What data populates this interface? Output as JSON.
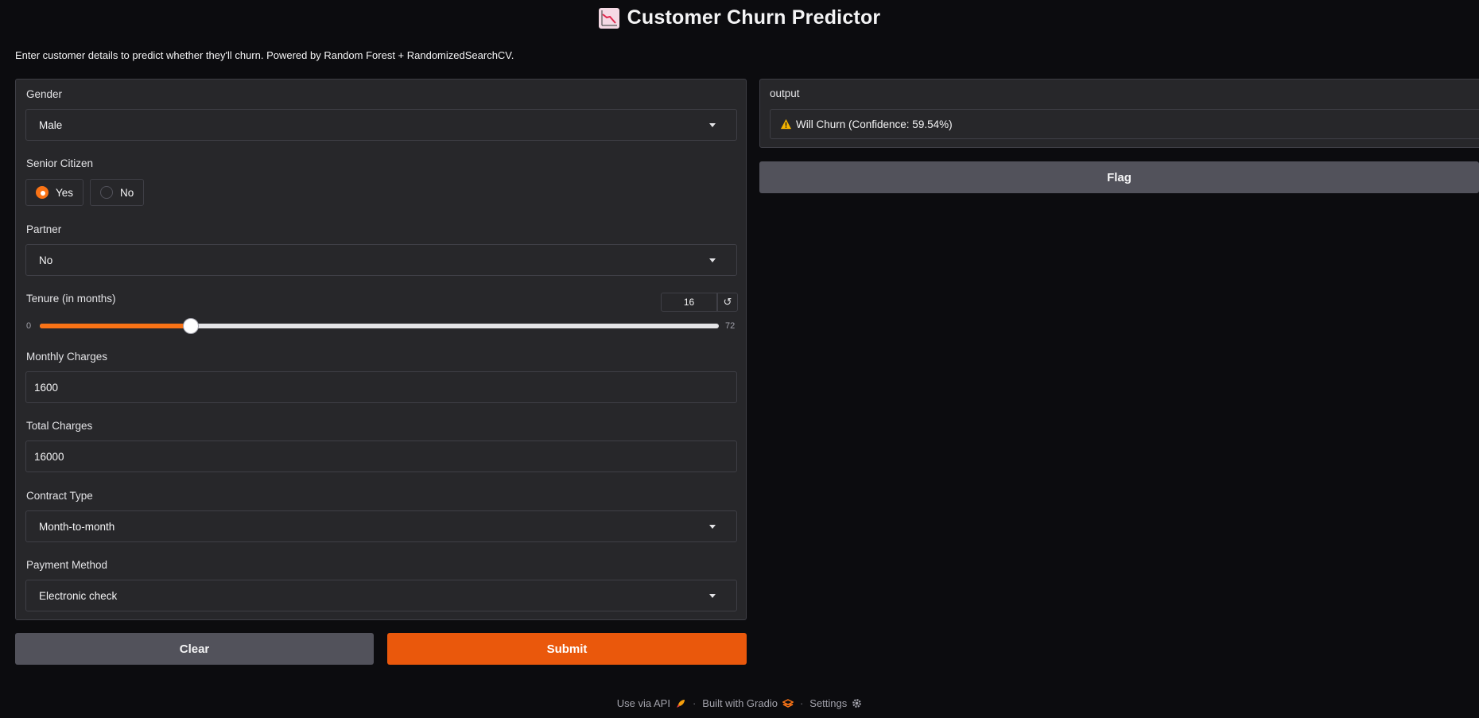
{
  "header": {
    "title": "Customer Churn Predictor",
    "description": "Enter customer details to predict whether they'll churn. Powered by Random Forest + RandomizedSearchCV."
  },
  "form": {
    "gender": {
      "label": "Gender",
      "value": "Male"
    },
    "senior_citizen": {
      "label": "Senior Citizen",
      "options": [
        "Yes",
        "No"
      ],
      "selected": "Yes"
    },
    "partner": {
      "label": "Partner",
      "value": "No"
    },
    "tenure": {
      "label": "Tenure (in months)",
      "value": "16",
      "min": "0",
      "max": "72"
    },
    "monthly_charges": {
      "label": "Monthly Charges",
      "value": "1600"
    },
    "total_charges": {
      "label": "Total Charges",
      "value": "16000"
    },
    "contract_type": {
      "label": "Contract Type",
      "value": "Month-to-month"
    },
    "payment_method": {
      "label": "Payment Method",
      "value": "Electronic check"
    }
  },
  "buttons": {
    "clear": "Clear",
    "submit": "Submit",
    "flag": "Flag"
  },
  "output": {
    "label": "output",
    "text": "Will Churn (Confidence: 59.54%)"
  },
  "footer": {
    "api": "Use via API",
    "built": "Built with Gradio",
    "settings": "Settings",
    "separator": "·"
  },
  "colors": {
    "accent": "#f97316",
    "primary_button": "#ea580c",
    "secondary_button": "#52525b",
    "background": "#0c0c0f",
    "panel": "#27272a"
  },
  "icons": {
    "title": "chart-decreasing-icon",
    "output": "warning-icon",
    "api": "rocket-icon",
    "gradio": "gradio-logo-icon",
    "settings": "gear-icon",
    "reset": "reset-icon",
    "dropdown": "chevron-down-icon"
  }
}
